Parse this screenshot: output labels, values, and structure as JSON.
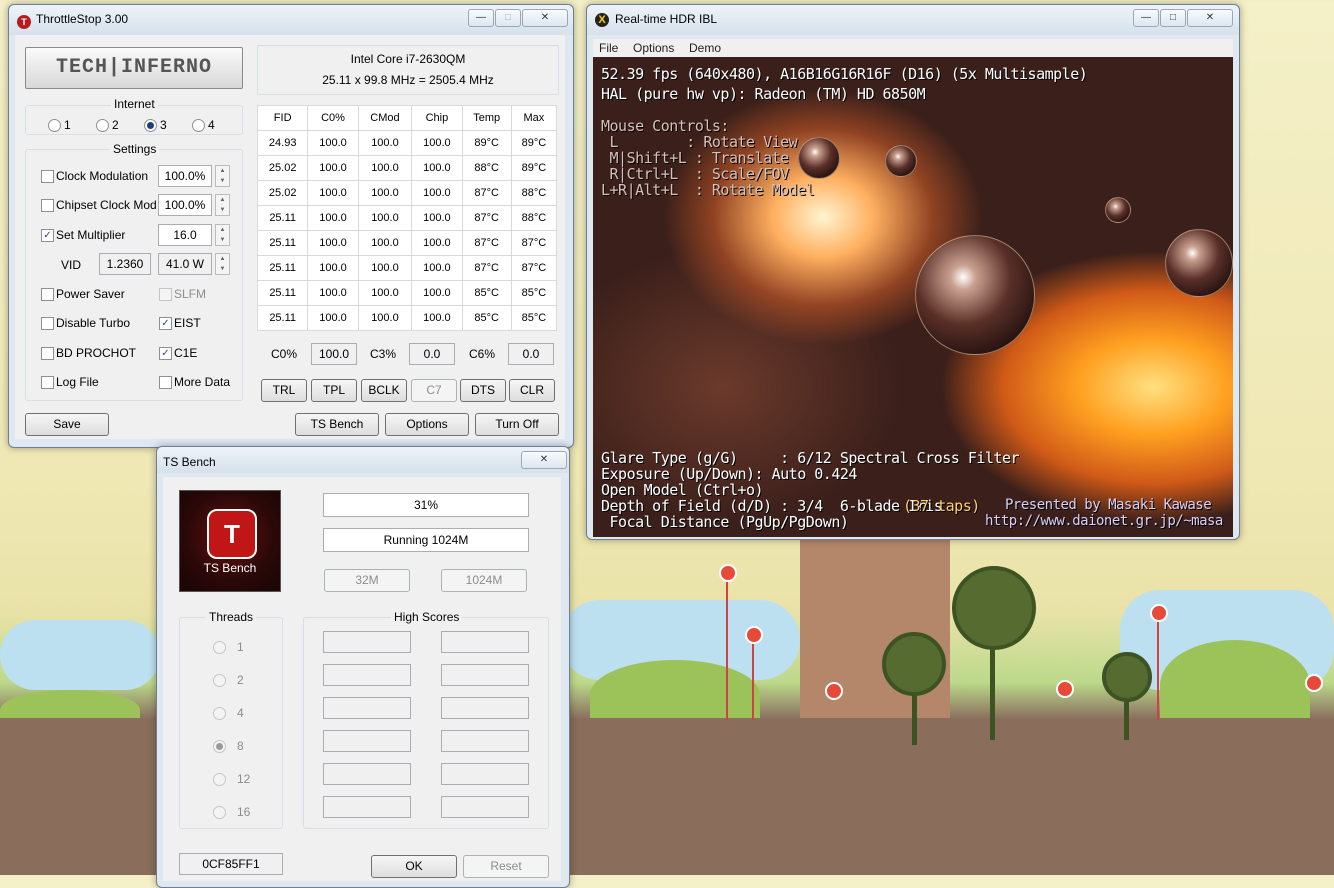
{
  "throttlestop": {
    "title": "ThrottleStop 3.00",
    "logo": "TECH|INFERNO",
    "cpu_name": "Intel Core i7-2630QM",
    "cpu_freq": "25.11 x 99.8 MHz = 2505.4 MHz",
    "internet_label": "Internet",
    "profiles": [
      {
        "label": "1",
        "checked": false
      },
      {
        "label": "2",
        "checked": false
      },
      {
        "label": "3",
        "checked": true
      },
      {
        "label": "4",
        "checked": false
      }
    ],
    "settings_label": "Settings",
    "clock_modulation": {
      "label": "Clock Modulation",
      "value": "100.0%"
    },
    "chipset_clock_mod": {
      "label": "Chipset Clock Mod",
      "value": "100.0%"
    },
    "set_multiplier": {
      "label": "Set Multiplier",
      "value": "16.0"
    },
    "vid": {
      "label": "VID",
      "value": "1.2360",
      "power": "41.0 W"
    },
    "power_saver": "Power Saver",
    "slfm": "SLFM",
    "disable_turbo": "Disable Turbo",
    "eist": "EIST",
    "bd_prochot": "BD PROCHOT",
    "c1e": "C1E",
    "log_file": "Log File",
    "more_data": "More Data",
    "table_headers": [
      "FID",
      "C0%",
      "CMod",
      "Chip",
      "Temp",
      "Max"
    ],
    "table_rows": [
      [
        "24.93",
        "100.0",
        "100.0",
        "100.0",
        "89°C",
        "89°C"
      ],
      [
        "25.02",
        "100.0",
        "100.0",
        "100.0",
        "88°C",
        "89°C"
      ],
      [
        "25.02",
        "100.0",
        "100.0",
        "100.0",
        "87°C",
        "88°C"
      ],
      [
        "25.11",
        "100.0",
        "100.0",
        "100.0",
        "87°C",
        "88°C"
      ],
      [
        "25.11",
        "100.0",
        "100.0",
        "100.0",
        "87°C",
        "87°C"
      ],
      [
        "25.11",
        "100.0",
        "100.0",
        "100.0",
        "87°C",
        "87°C"
      ],
      [
        "25.11",
        "100.0",
        "100.0",
        "100.0",
        "85°C",
        "85°C"
      ],
      [
        "25.11",
        "100.0",
        "100.0",
        "100.0",
        "85°C",
        "85°C"
      ]
    ],
    "cstates": {
      "c0_label": "C0%",
      "c0_value": "100.0",
      "c3_label": "C3%",
      "c3_value": "0.0",
      "c6_label": "C6%",
      "c6_value": "0.0"
    },
    "buttons": {
      "trl": "TRL",
      "tpl": "TPL",
      "bclk": "BCLK",
      "c7": "C7",
      "dts": "DTS",
      "clr": "CLR",
      "save": "Save",
      "ts_bench": "TS Bench",
      "options": "Options",
      "turn_off": "Turn Off"
    }
  },
  "tsbench": {
    "title": "TS Bench",
    "logo_text": "TS Bench",
    "progress_text": "31%",
    "status_text": "Running 1024M",
    "size_buttons": [
      "32M",
      "1024M"
    ],
    "threads_label": "Threads",
    "threads": [
      {
        "label": "1",
        "checked": false
      },
      {
        "label": "2",
        "checked": false
      },
      {
        "label": "4",
        "checked": false
      },
      {
        "label": "8",
        "checked": true
      },
      {
        "label": "12",
        "checked": false
      },
      {
        "label": "16",
        "checked": false
      }
    ],
    "high_scores_label": "High Scores",
    "id_value": "0CF85FF1",
    "ok": "OK",
    "reset": "Reset"
  },
  "hdr": {
    "title": "Real-time HDR IBL",
    "menu": [
      "File",
      "Options",
      "Demo"
    ],
    "hud_fps": "52.39 fps (640x480), A16B16G16R16F (D16) (5x Multisample)",
    "hud_hal": "HAL (pure hw vp): Radeon (TM) HD 6850M",
    "mouse_title": "Mouse Controls:",
    "mouse_lines": [
      " L        : Rotate View",
      " M|Shift+L : Translate",
      " R|Ctrl+L  : Scale/FOV",
      "L+R|Alt+L  : Rotate Model"
    ],
    "glare": "Glare Type (g/G)     : 6/12 Spectral Cross Filter",
    "exposure": "Exposure (Up/Down): Auto 0.424",
    "open_model": "Open Model (Ctrl+o)",
    "dof": "Depth of Field (d/D) : 3/4  6-blade Iris",
    "dof_taps": "(37 taps)",
    "focal": " Focal Distance (PgUp/PgDown)",
    "credit1": "Presented by Masaki Kawase",
    "credit2": "http://www.daionet.gr.jp/~masa"
  },
  "window_buttons": {
    "minimize": "—",
    "maximize": "□",
    "close": "✕"
  }
}
